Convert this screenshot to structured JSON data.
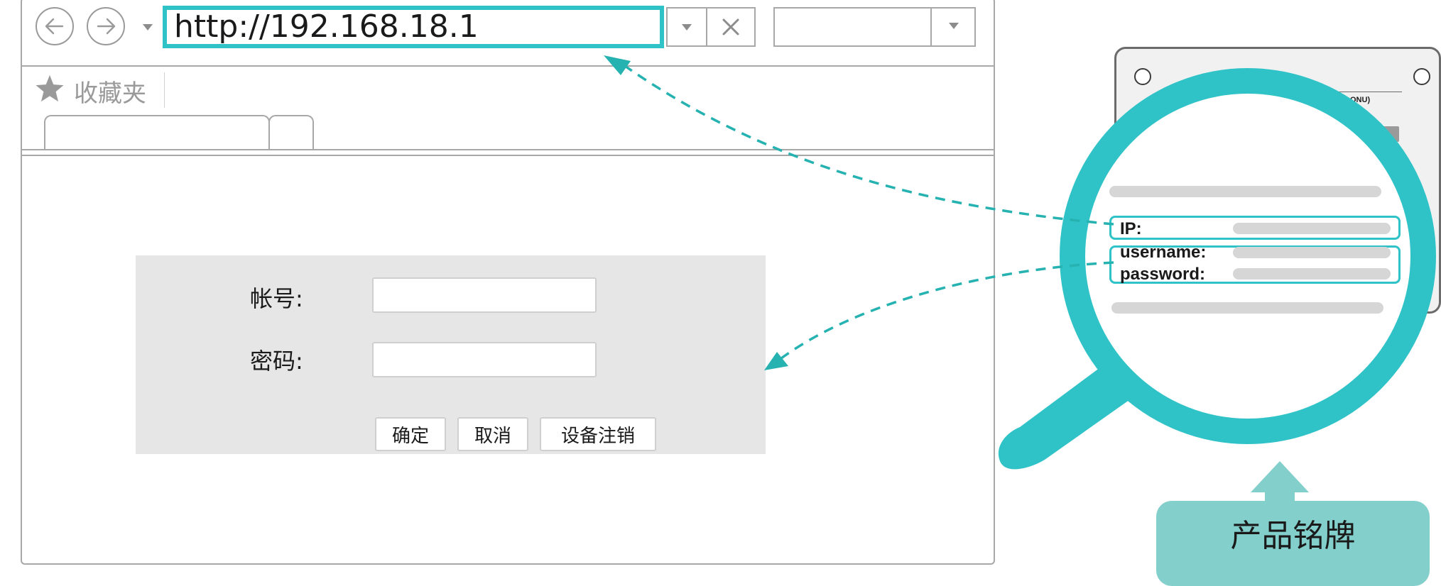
{
  "browser": {
    "url": "http://192.168.18.1",
    "favorites_label": "收藏夹"
  },
  "login_form": {
    "account_label": "帐号:",
    "password_label": "密码:",
    "account_value": "",
    "password_value": "",
    "confirm_label": "确定",
    "cancel_label": "取消",
    "deregister_label": "设备注销"
  },
  "device_label": {
    "model_fragment": "N ONU)",
    "ip_label": "IP:",
    "username_label": "username:",
    "password_label": "password:"
  },
  "caption": {
    "text": "产品铭牌"
  },
  "colors": {
    "accent": "#2fc3c8",
    "caption_bg": "#82cfcc",
    "panel_bg": "#e6e6e6"
  },
  "icons": [
    "back-arrow-icon",
    "forward-arrow-icon",
    "star-icon",
    "close-icon",
    "dropdown-caret-icon",
    "magnifier-icon"
  ]
}
